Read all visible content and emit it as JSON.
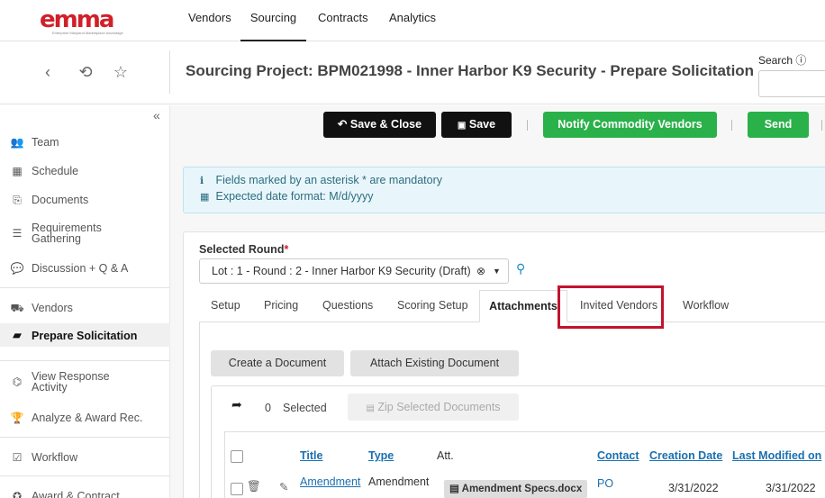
{
  "brand": {
    "logo_text": "emma",
    "tagline": "Enterprise Maryland Marketplace Advantage"
  },
  "topnav": {
    "items": [
      {
        "label": "Vendors",
        "active": false
      },
      {
        "label": "Sourcing",
        "active": true
      },
      {
        "label": "Contracts",
        "active": false
      },
      {
        "label": "Analytics",
        "active": false
      }
    ]
  },
  "header": {
    "title": "Sourcing Project: BPM021998 - Inner Harbor K9 Security - Prepare Solicitation",
    "search_label": "Search",
    "icons": [
      "back-icon",
      "history-icon",
      "star-icon",
      "info-icon"
    ]
  },
  "sidebar": {
    "collapse_glyph": "«",
    "items": [
      {
        "label": "Team",
        "icon": "team-icon"
      },
      {
        "label": "Schedule",
        "icon": "calendar-icon"
      },
      {
        "label": "Documents",
        "icon": "documents-icon"
      },
      {
        "label": "Requirements Gathering",
        "icon": "list-icon"
      },
      {
        "label": "Discussion + Q & A",
        "icon": "discussion-icon"
      },
      {
        "label": "Vendors",
        "icon": "truck-icon"
      },
      {
        "label": "Prepare Solicitation",
        "icon": "folder-open-icon",
        "active": true
      },
      {
        "label": "View Response Activity",
        "icon": "binoculars-icon"
      },
      {
        "label": "Analyze & Award Rec.",
        "icon": "trophy-icon"
      },
      {
        "label": "Workflow",
        "icon": "check-square-icon"
      },
      {
        "label": "Award & Contract",
        "icon": "award-icon"
      }
    ]
  },
  "toolbar": {
    "save_close": "Save & Close",
    "save": "Save",
    "notify": "Notify Commodity Vendors",
    "send": "Send"
  },
  "info": {
    "mandatory": "Fields marked by an asterisk * are mandatory",
    "date_format": "Expected date format: M/d/yyyy"
  },
  "round": {
    "label": "Selected Round",
    "required_mark": "*",
    "value": "Lot : 1 - Round : 2 - Inner Harbor K9 Security (Draft)"
  },
  "tabs": [
    {
      "label": "Setup"
    },
    {
      "label": "Pricing"
    },
    {
      "label": "Questions"
    },
    {
      "label": "Scoring Setup"
    },
    {
      "label": "Attachments",
      "active": true
    },
    {
      "label": "Invited Vendors",
      "highlighted": true
    },
    {
      "label": "Workflow"
    }
  ],
  "attachments": {
    "create_doc": "Create a Document",
    "attach_existing": "Attach Existing Document",
    "selected_count": "0",
    "selected_label": "Selected",
    "zip_label": "Zip Selected Documents",
    "columns": {
      "title": "Title",
      "type": "Type",
      "att": "Att.",
      "contact": "Contact",
      "creation_date": "Creation Date",
      "last_modified": "Last Modified on"
    },
    "rows": [
      {
        "title": "Amendment",
        "type": "Amendment",
        "att": "Amendment Specs.docx",
        "contact": "PO",
        "creation_date": "3/31/2022",
        "last_modified": "3/31/2022"
      }
    ]
  },
  "colors": {
    "green": "#2ab14a",
    "dark": "#111111",
    "link": "#1a6fb0",
    "highlight": "#c3132e",
    "brand_red": "#d0202a"
  }
}
